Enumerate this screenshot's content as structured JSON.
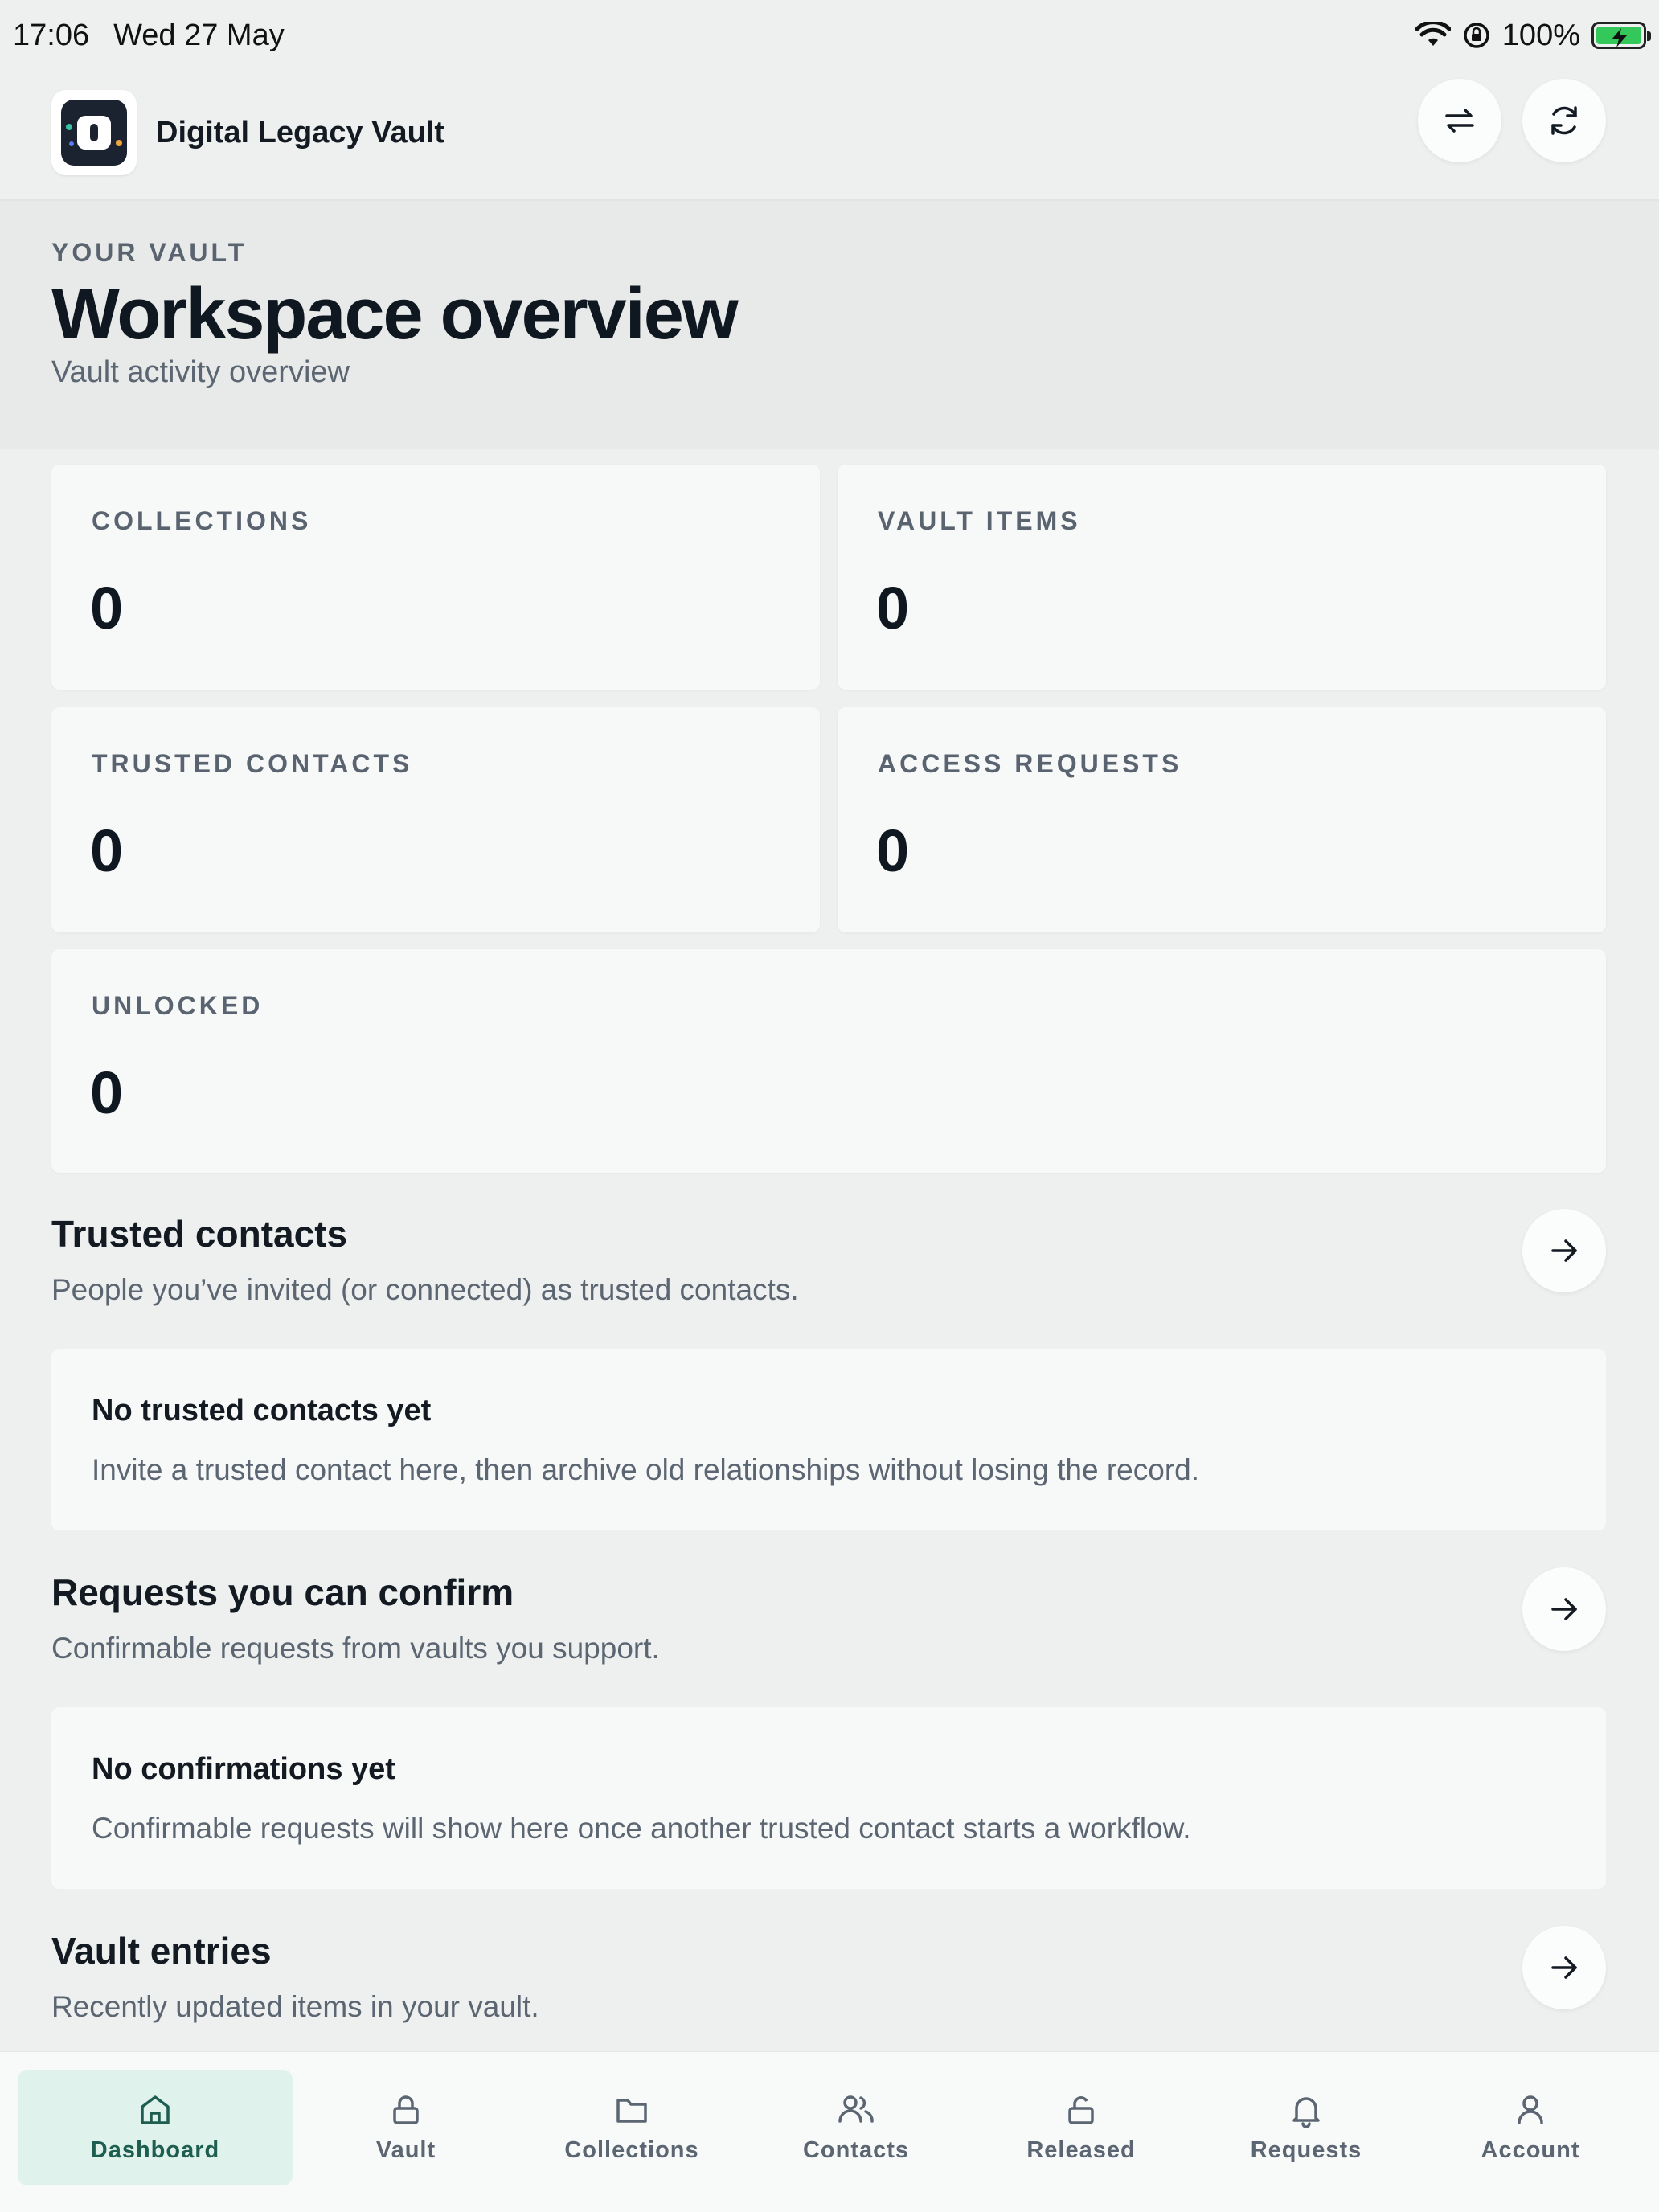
{
  "status_bar": {
    "time": "17:06",
    "date": "Wed 27 May",
    "battery": "100%",
    "icons": [
      "wifi-icon",
      "orientation-lock-icon",
      "battery-charging-icon"
    ]
  },
  "app": {
    "title": "Digital Legacy Vault",
    "logo_icon": "vault-lock-icon",
    "header_buttons": [
      "switch-icon",
      "refresh-icon"
    ]
  },
  "hero": {
    "eyebrow": "YOUR VAULT",
    "title": "Workspace overview",
    "subtitle": "Vault activity overview"
  },
  "stats": [
    {
      "label": "COLLECTIONS",
      "value": "0"
    },
    {
      "label": "VAULT ITEMS",
      "value": "0"
    },
    {
      "label": "TRUSTED CONTACTS",
      "value": "0"
    },
    {
      "label": "ACCESS REQUESTS",
      "value": "0"
    },
    {
      "label": "UNLOCKED",
      "value": "0"
    }
  ],
  "sections": [
    {
      "title": "Trusted contacts",
      "description": "People you’ve invited (or connected) as trusted contacts.",
      "empty_title": "No trusted contacts yet",
      "empty_description": "Invite a trusted contact here, then archive old relationships without losing the record."
    },
    {
      "title": "Requests you can confirm",
      "description": "Confirmable requests from vaults you support.",
      "empty_title": "No confirmations yet",
      "empty_description": "Confirmable requests will show here once another trusted contact starts a workflow."
    },
    {
      "title": "Vault entries",
      "description": "Recently updated items in your vault."
    }
  ],
  "bottom_nav": [
    {
      "label": "Dashboard",
      "icon": "home-icon",
      "active": true
    },
    {
      "label": "Vault",
      "icon": "lock-icon",
      "active": false
    },
    {
      "label": "Collections",
      "icon": "folder-icon",
      "active": false
    },
    {
      "label": "Contacts",
      "icon": "users-icon",
      "active": false
    },
    {
      "label": "Released",
      "icon": "unlock-icon",
      "active": false
    },
    {
      "label": "Requests",
      "icon": "bell-icon",
      "active": false
    },
    {
      "label": "Account",
      "icon": "user-icon",
      "active": false
    }
  ],
  "colors": {
    "background": "#eef0ef",
    "card": "#f7f8f8",
    "accent_active_bg": "#dff2ec",
    "accent_active_text": "#1e5e50",
    "battery_green": "#34c759"
  }
}
